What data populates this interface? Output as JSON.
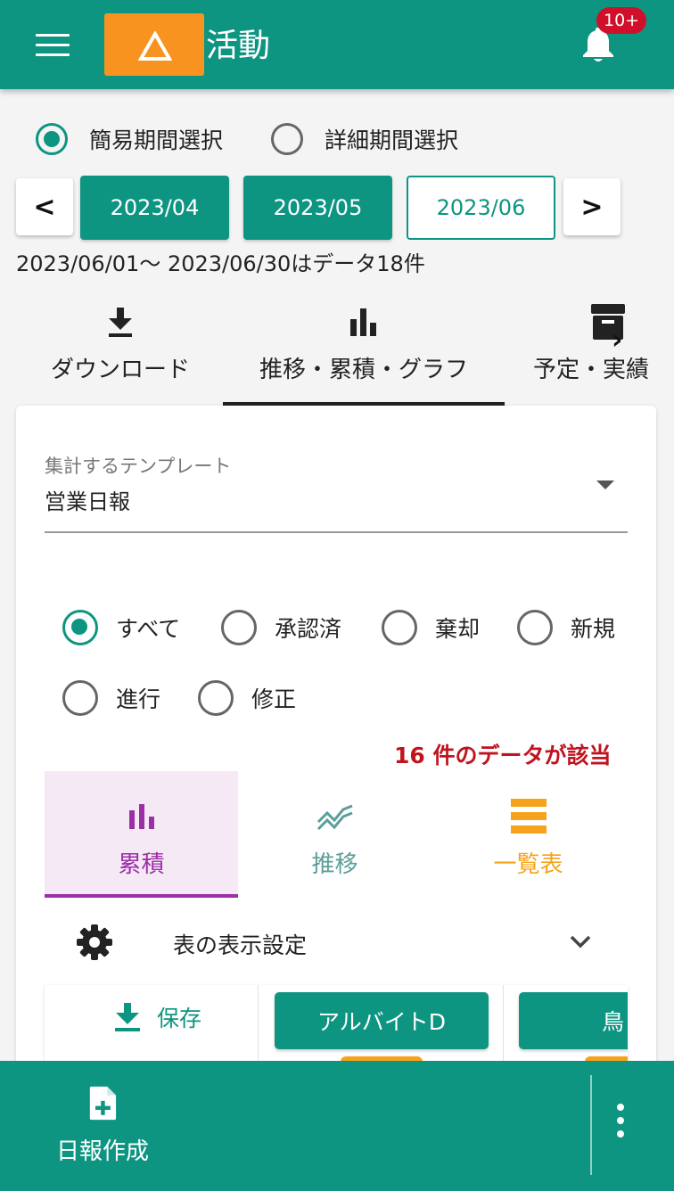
{
  "header": {
    "title": "活動",
    "notification_badge": "10+",
    "brand_color": "#0e9582",
    "logo_color": "#f7931e",
    "icons": [
      "menu-icon",
      "logo-triangle-icon",
      "bell-icon"
    ]
  },
  "period": {
    "simple_label": "簡易期間選択",
    "detail_label": "詳細期間選択",
    "selected": "simple",
    "months": [
      "2023/04",
      "2023/05",
      "2023/06"
    ],
    "selected_month": "2023/06",
    "prev_label": "<",
    "next_label": ">",
    "range_text": "2023/06/01～ 2023/06/30はデータ18件"
  },
  "tabs": {
    "items": [
      {
        "label": "ダウンロード",
        "icon": "download-icon"
      },
      {
        "label": "推移・累積・グラフ",
        "icon": "bar-chart-icon"
      },
      {
        "label": "予定・実績",
        "icon": "archive-icon"
      }
    ],
    "active": 1,
    "scroll_label": "›"
  },
  "template": {
    "label": "集計するテンプレート",
    "value": "営業日報"
  },
  "filters": {
    "options": [
      "すべて",
      "承認済",
      "棄却",
      "新規",
      "進行",
      "修正"
    ],
    "selected": "すべて"
  },
  "hit_count_text": "16 件のデータが該当",
  "view_tabs": {
    "items": [
      {
        "label": "累積",
        "icon": "bar-chart-icon",
        "color": "#9b2fa6"
      },
      {
        "label": "推移",
        "icon": "trend-icon",
        "color": "#5b9e9a"
      },
      {
        "label": "一覧表",
        "icon": "list-icon",
        "color": "#f7a21c"
      }
    ],
    "active": 0
  },
  "table_settings": {
    "label": "表の表示設定"
  },
  "table": {
    "save_label": "保存",
    "columns": [
      "アルバイトD",
      "鳥"
    ]
  },
  "bottom": {
    "new_report_label": "日報作成"
  }
}
